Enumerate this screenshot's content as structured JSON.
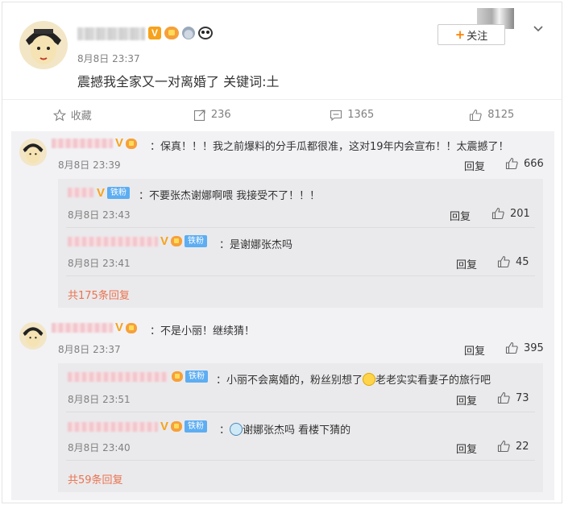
{
  "post": {
    "time": "8月8日 23:37",
    "text": "震撼我全家又一对离婚了 关键词:土",
    "follow_label": "关注",
    "follow_plus": "+"
  },
  "actions": {
    "favorite": "收藏",
    "repost": "236",
    "comment": "1365",
    "like": "8125"
  },
  "comments": [
    {
      "text": "：保真！！！我之前爆料的分手瓜都很准，这对19年内会宣布！！太震撼了！",
      "time": "8月8日 23:39",
      "reply": "回复",
      "likes": "666",
      "replies": [
        {
          "badge": "铁粉",
          "text": "：不要张杰谢娜啊喂 我接受不了！！！",
          "time": "8月8日 23:43",
          "reply": "回复",
          "likes": "201"
        },
        {
          "badge": "铁粉",
          "text": "：是谢娜张杰吗",
          "time": "8月8日 23:41",
          "reply": "回复",
          "likes": "45"
        }
      ],
      "more": "共175条回复"
    },
    {
      "text": "：不是小丽！继续猜！",
      "time": "8月8日 23:37",
      "reply": "回复",
      "likes": "395",
      "replies": [
        {
          "badge": "铁粉",
          "text_a": "：小丽不会离婚的，粉丝别想了",
          "text_b": "老老实实看妻子的旅行吧",
          "time": "8月8日 23:51",
          "reply": "回复",
          "likes": "73"
        },
        {
          "badge": "铁粉",
          "text_a": "：",
          "text_b": "谢娜张杰吗 看楼下猜的",
          "time": "8月8日 23:40",
          "reply": "回复",
          "likes": "22"
        }
      ],
      "more": "共59条回复"
    }
  ]
}
